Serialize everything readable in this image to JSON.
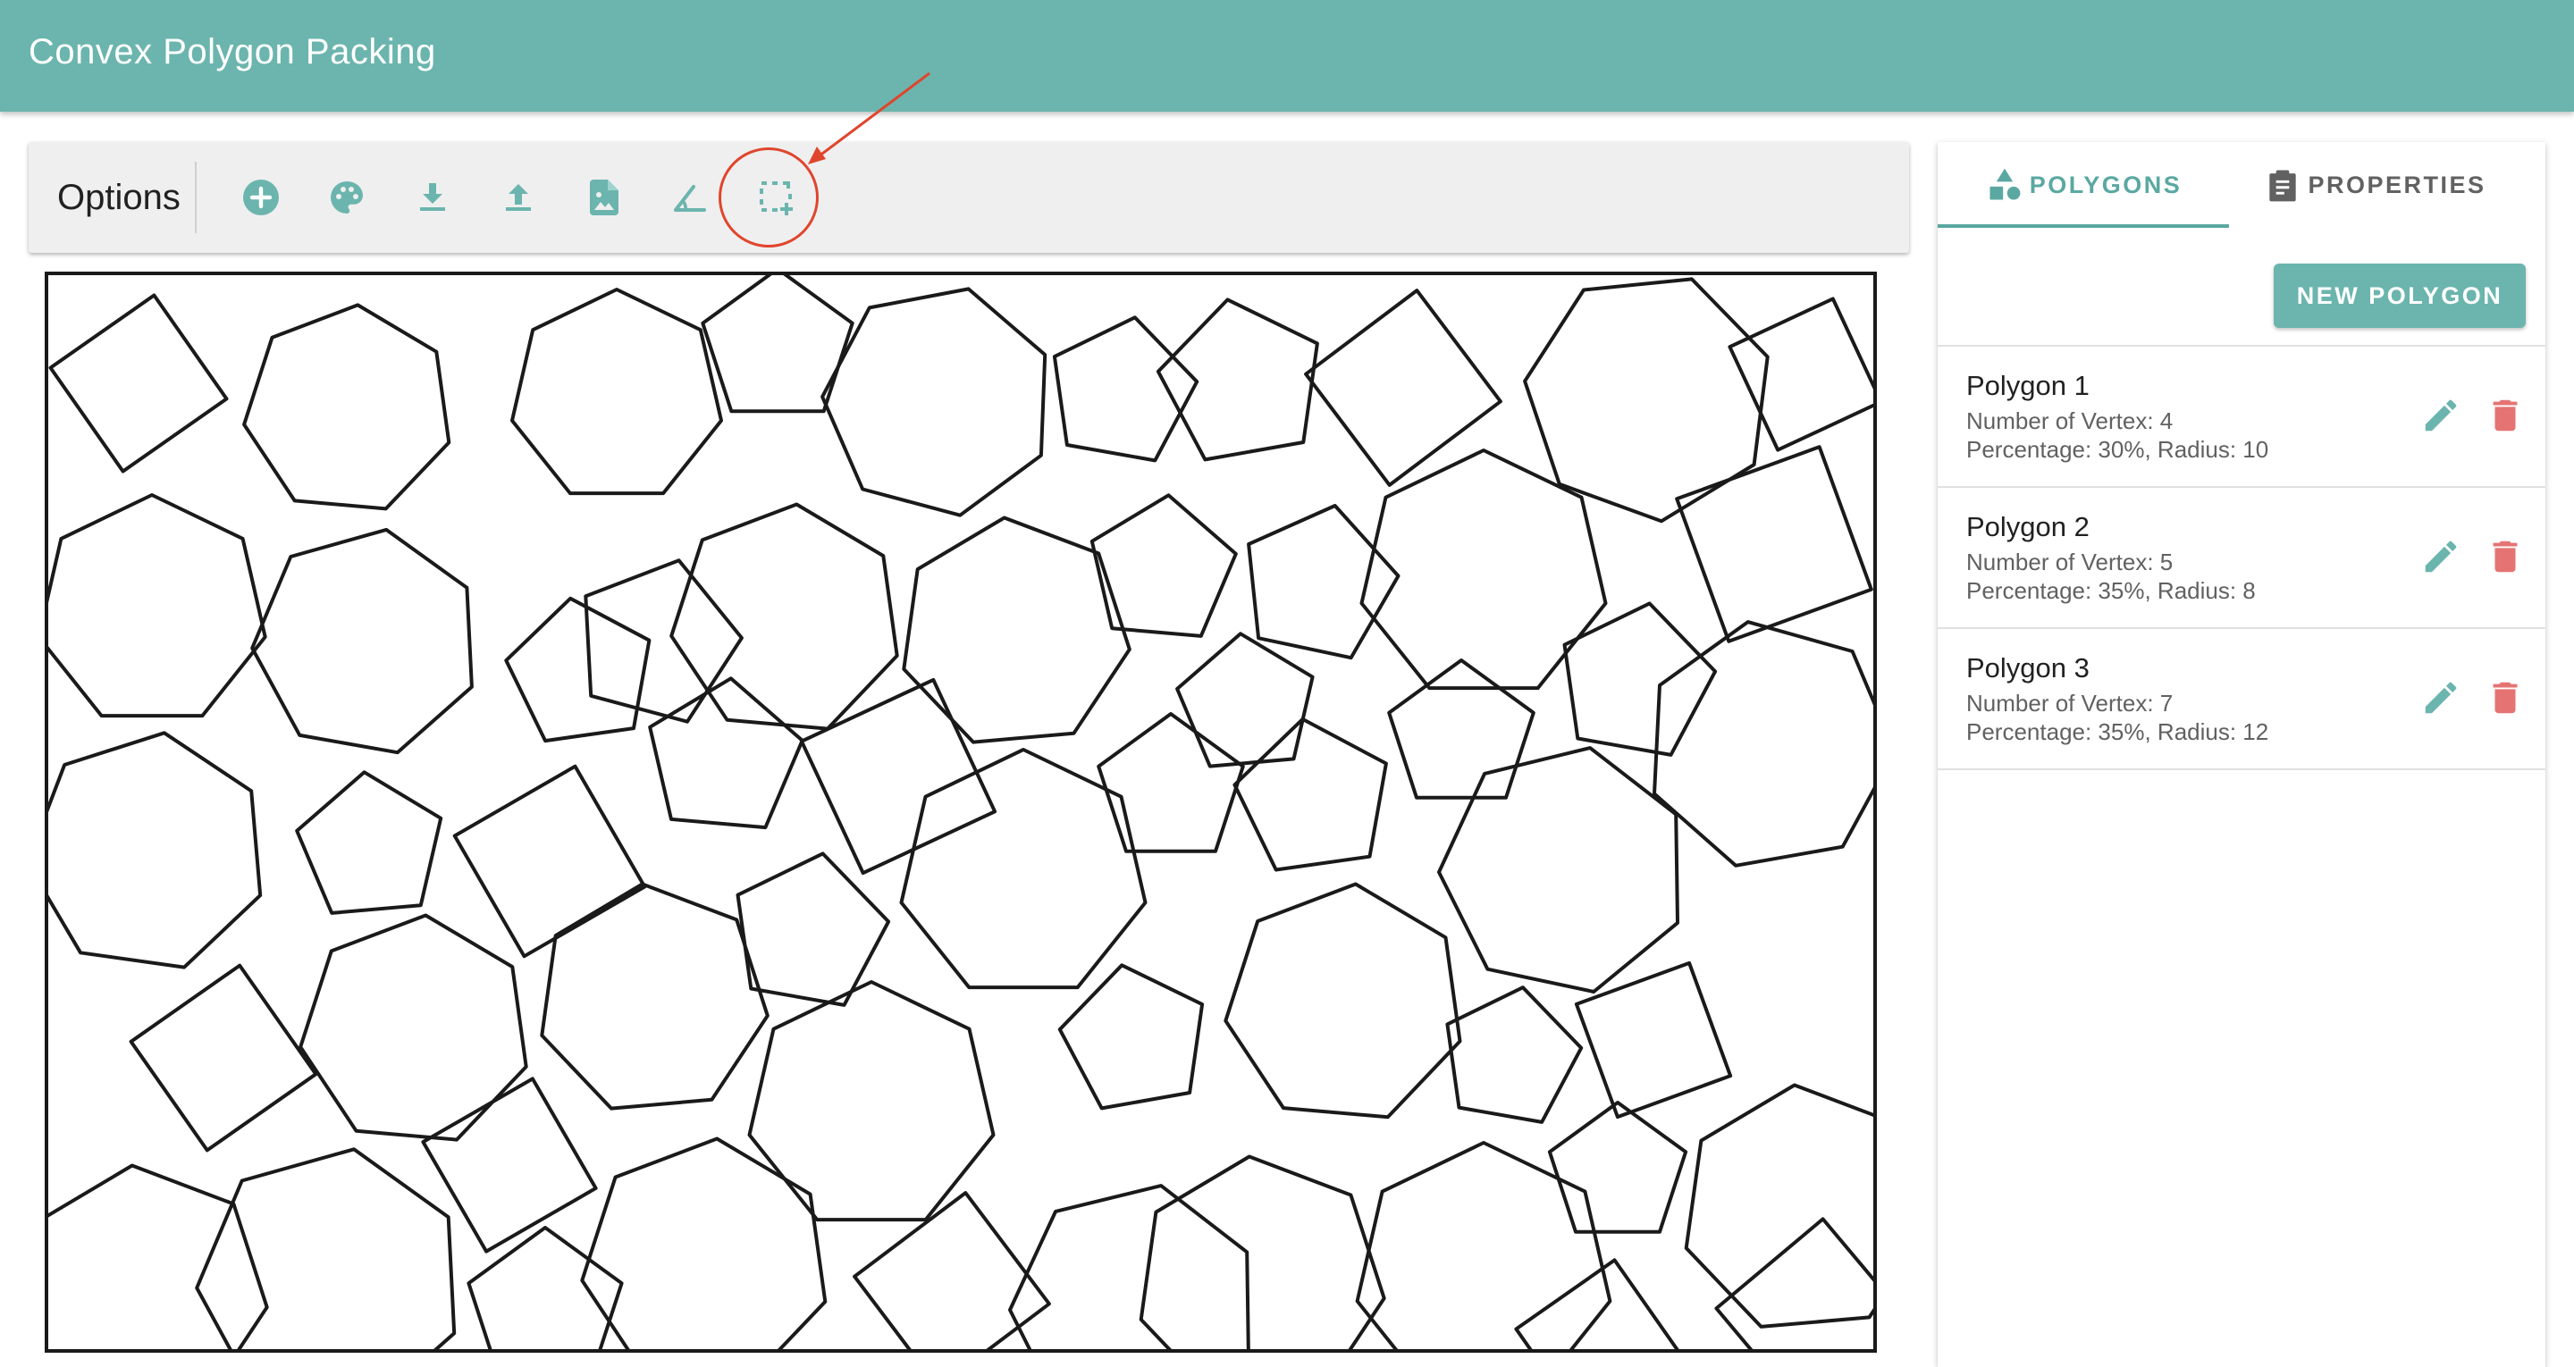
{
  "app": {
    "title": "Convex Polygon Packing"
  },
  "options": {
    "label": "Options",
    "tools": [
      {
        "icon": "add-circle-icon"
      },
      {
        "icon": "palette-icon"
      },
      {
        "icon": "download-icon"
      },
      {
        "icon": "upload-icon"
      },
      {
        "icon": "image-file-icon"
      },
      {
        "icon": "angle-icon"
      },
      {
        "icon": "select-area-add-icon"
      }
    ]
  },
  "panel": {
    "tabs": [
      {
        "label": "POLYGONS",
        "icon": "shapes-icon",
        "active": true
      },
      {
        "label": "PROPERTIES",
        "icon": "clipboard-icon",
        "active": false
      }
    ],
    "new_button": "NEW POLYGON",
    "polygons": [
      {
        "name": "Polygon 1",
        "vertex_text": "Number of Vertex: 4",
        "detail_text": "Percentage: 30%, Radius: 10"
      },
      {
        "name": "Polygon 2",
        "vertex_text": "Number of Vertex: 5",
        "detail_text": "Percentage: 35%, Radius: 8"
      },
      {
        "name": "Polygon 3",
        "vertex_text": "Number of Vertex: 7",
        "detail_text": "Percentage: 35%, Radius: 12"
      }
    ]
  },
  "colors": {
    "primary": "#6bb5ae",
    "accent_text": "#5aa8a1",
    "edit_icon": "#6bb5ae",
    "delete_icon": "#e57373",
    "annotation": "#e0452d"
  }
}
